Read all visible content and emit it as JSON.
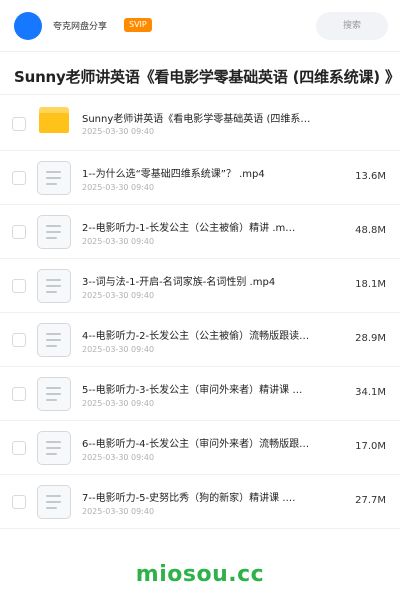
{
  "header": {
    "app_name": "夸克网盘分享",
    "badge": "SVIP",
    "search_placeholder": "搜索"
  },
  "page_title": "Sunny老师讲英语《看电影学零基础英语 (四维系统课) 》",
  "files": [
    {
      "type": "folder",
      "name": "Sunny老师讲英语《看电影学零基础英语 (四维系…",
      "date": "2025-03-30 09:40",
      "size": ""
    },
    {
      "type": "file",
      "name": "1--为什么选“零基础四维系统课”？ .mp4",
      "date": "2025-03-30 09:40",
      "size": "13.6M"
    },
    {
      "type": "file",
      "name": "2--电影听力-1-长发公主（公主被偷）精讲 .m…",
      "date": "2025-03-30 09:40",
      "size": "48.8M"
    },
    {
      "type": "file",
      "name": "3--词与法-1-开启-名词家族-名词性别 .mp4",
      "date": "2025-03-30 09:40",
      "size": "18.1M"
    },
    {
      "type": "file",
      "name": "4--电影听力-2-长发公主（公主被偷）流畅版跟读…",
      "date": "2025-03-30 09:40",
      "size": "28.9M"
    },
    {
      "type": "file",
      "name": "5--电影听力-3-长发公主（审问外来者）精讲课 …",
      "date": "2025-03-30 09:40",
      "size": "34.1M"
    },
    {
      "type": "file",
      "name": "6--电影听力-4-长发公主（审问外来者）流畅版跟…",
      "date": "2025-03-30 09:40",
      "size": "17.0M"
    },
    {
      "type": "file",
      "name": "7--电影听力-5-史努比秀（狗的新家）精讲课 .…",
      "date": "2025-03-30 09:40",
      "size": "27.7M"
    }
  ],
  "watermark": "miosou.cc",
  "colors": {
    "accent": "#1677ff",
    "badge": "#ff8a00",
    "folder": "#ffc21a",
    "watermark": "#2fb14a"
  }
}
